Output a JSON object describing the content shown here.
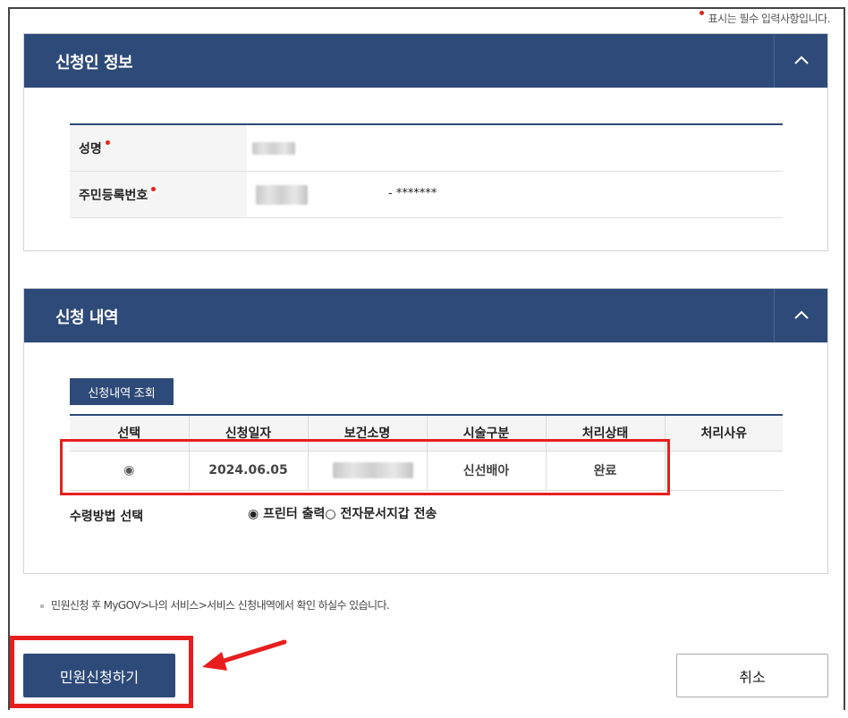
{
  "required_note": "표시는 필수 입력사항입니다.",
  "applicant_section": {
    "title": "신청인 정보",
    "fields": [
      {
        "label": "성명",
        "value_masked": true
      },
      {
        "label": "주민등록번호",
        "value_masked": true,
        "suffix": "- *******"
      }
    ]
  },
  "history_section": {
    "title": "신청 내역",
    "query_button": "신청내역 조회",
    "columns": [
      "선택",
      "신청일자",
      "보건소명",
      "시술구분",
      "처리상태",
      "처리사유"
    ],
    "rows": [
      {
        "select": "◉",
        "date": "2024.06.05",
        "center_masked": true,
        "procedure": "신선배아",
        "status": "완료",
        "reason": ""
      }
    ],
    "receive_label": "수령방법 선택",
    "receive_options": "◉ 프린터 출력○ 전자문서지갑 전송"
  },
  "notice": "민원신청 후 MyGOV>나의 서비스>서비스 신청내역에서 확인 하실수 있습니다.",
  "buttons": {
    "apply": "민원신청하기",
    "cancel": "취소"
  },
  "colors": {
    "header": "#2e4a78",
    "required_dot": "#e0261a",
    "highlight": "#e81e1e"
  },
  "icons": [
    "chevron-up-icon",
    "arrow-left-icon"
  ]
}
